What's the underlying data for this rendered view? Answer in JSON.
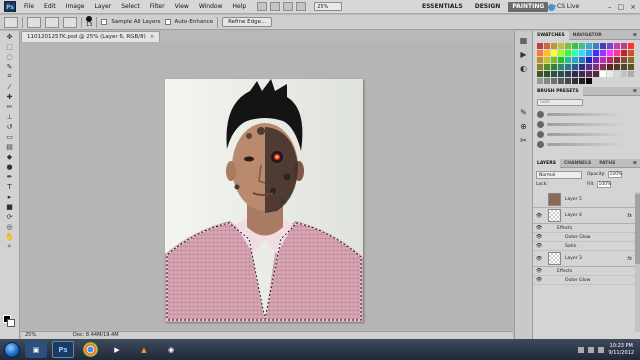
{
  "app": {
    "logo": "Ps",
    "menu": [
      "File",
      "Edit",
      "Image",
      "Layer",
      "Select",
      "Filter",
      "View",
      "Window",
      "Help"
    ],
    "zoom_dropdown": "25%",
    "workspaces": [
      "ESSENTIALS",
      "DESIGN",
      "PAINTING"
    ],
    "active_workspace": "PAINTING",
    "more": "»",
    "cs_live": "CS Live",
    "window_controls": [
      "–",
      "□",
      "×"
    ]
  },
  "options": {
    "brush_size": "13",
    "sample_all_layers": "Sample All Layers",
    "auto_enhance": "Auto-Enhance",
    "refine_edge": "Refine Edge..."
  },
  "document": {
    "tab_title": "1101201257K.psd @ 25% (Layer 6, RGB/8)",
    "close": "×",
    "zoom": "25%",
    "doc_info": "Doc: 8.44M/19.4M"
  },
  "panels": {
    "swatches_tabs": [
      "SWATCHES",
      "NAVIGATOR"
    ],
    "brush_presets_title": "BRUSH PRESETS",
    "brush_size_label": "Size:",
    "layers_tabs": [
      "LAYERS",
      "CHANNELS",
      "PATHS"
    ],
    "blend_mode": "Normal",
    "opacity_label": "Opacity:",
    "opacity_value": "100%",
    "lock_label": "Lock:",
    "fill_label": "Fill:",
    "fill_value": "100%",
    "layers": [
      {
        "name": "Layer 5",
        "visible": false,
        "fx": false,
        "thumb": "photo"
      },
      {
        "name": "Layer 4",
        "visible": true,
        "fx": true,
        "thumb": "transparent"
      },
      {
        "name": "Layer 3",
        "visible": true,
        "fx": true,
        "thumb": "transparent"
      }
    ],
    "layer4_effects": [
      "Effects",
      "Outer Glow",
      "Satin"
    ],
    "layer3_effects": [
      "Effects",
      "Outer Glow"
    ],
    "fx_label": "fx"
  },
  "taskbar": {
    "ps_label": "Ps",
    "time": "10:23 PM",
    "date": "9/11/2012"
  },
  "colors": {
    "foreground": "#000000",
    "background": "#ffffff",
    "selection": "#7a9cc6"
  }
}
